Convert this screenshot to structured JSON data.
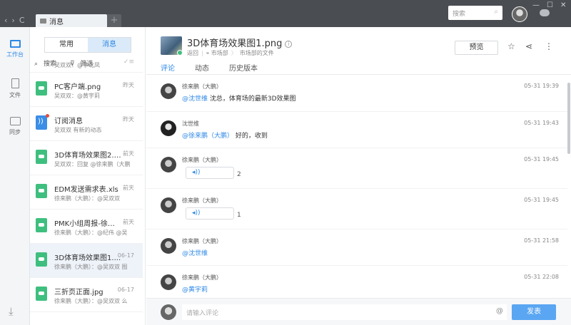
{
  "window": {
    "tab_label": "消息",
    "tab_add": "+",
    "search_placeholder": "搜索"
  },
  "rail": {
    "items": [
      {
        "label": "工作台",
        "active": true
      },
      {
        "label": "文件",
        "active": false
      },
      {
        "label": "同步",
        "active": false
      }
    ]
  },
  "list": {
    "segments": [
      "常用",
      "消息"
    ],
    "active_segment": "消息",
    "search_label": "搜索",
    "filter_label": "筛选",
    "partial_top": "吴双双：@李北凤",
    "items": [
      {
        "title": "PC客户端.png",
        "time": "昨天",
        "sub": "吴双双：@黄宇莉",
        "icon": "file",
        "unread": false,
        "selected": false
      },
      {
        "title": "订阅消息",
        "time": "昨天",
        "sub": "吴双双 有新的动态",
        "icon": "rss",
        "unread": true,
        "selected": false
      },
      {
        "title": "3D体育场效果图2.png",
        "time": "前天",
        "sub": "吴双双：回复 @徐来鹏（大鹏",
        "icon": "file",
        "unread": false,
        "selected": false
      },
      {
        "title": "EDM发送需求表.xls",
        "time": "前天",
        "sub": "徐来鹏（大鹏）：@吴双双",
        "icon": "file",
        "unread": false,
        "selected": false
      },
      {
        "title": "PMK小组周报-徐来...",
        "time": "前天",
        "sub": "徐来鹏（大鹏）：@纪伟 @吴",
        "icon": "file",
        "unread": false,
        "selected": false
      },
      {
        "title": "3D体育场效果图1....",
        "time": "06-17",
        "sub": "徐来鹏（大鹏）：@吴双双 图",
        "icon": "file",
        "unread": false,
        "selected": true
      },
      {
        "title": "三折页正面.jpg",
        "time": "06-17",
        "sub": "徐来鹏（大鹏）：@吴双双 么",
        "icon": "file",
        "unread": false,
        "selected": false
      }
    ]
  },
  "file": {
    "title": "3D体育场效果图1.png",
    "back": "返回",
    "crumb_1": "市场部",
    "crumb_2": "市场部的文件",
    "preview_label": "预览",
    "tabs": [
      "评论",
      "动态",
      "历史版本"
    ],
    "active_tab": "评论"
  },
  "comments": [
    {
      "author": "徐来鹏（大鹏）",
      "time": "05-31 19:39",
      "mention": "@沈世维",
      "text": " 沈总，体育场的最新3D效果图",
      "type": "text",
      "avatar": "a"
    },
    {
      "author": "沈世维",
      "time": "05-31 19:43",
      "mention": "@徐来鹏（大鹏）",
      "text": " 好的，收到",
      "type": "text",
      "avatar": "b"
    },
    {
      "author": "徐来鹏（大鹏）",
      "time": "05-31 19:45",
      "voice_count": "2",
      "type": "voice",
      "avatar": "a"
    },
    {
      "author": "徐来鹏（大鹏）",
      "time": "05-31 19:45",
      "voice_count": "1",
      "type": "voice",
      "avatar": "a"
    },
    {
      "author": "徐来鹏（大鹏）",
      "time": "05-31 21:58",
      "mention": "@沈世维",
      "text": "",
      "type": "text",
      "avatar": "a"
    },
    {
      "author": "徐来鹏（大鹏）",
      "time": "05-31 22:08",
      "mention": "@黄宇莉",
      "text": "",
      "type": "text",
      "avatar": "a"
    }
  ],
  "composer": {
    "placeholder": "请输入评论",
    "at_symbol": "@",
    "send_label": "发表"
  }
}
